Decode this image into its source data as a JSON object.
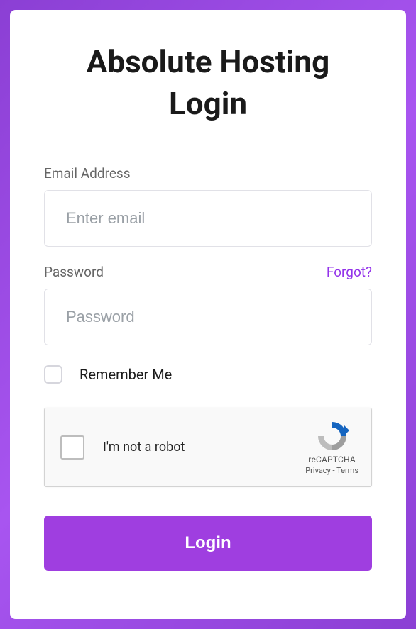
{
  "title": "Absolute Hosting Login",
  "email": {
    "label": "Email Address",
    "placeholder": "Enter email",
    "value": ""
  },
  "password": {
    "label": "Password",
    "placeholder": "Password",
    "value": "",
    "forgot_label": "Forgot?"
  },
  "remember": {
    "label": "Remember Me",
    "checked": false
  },
  "recaptcha": {
    "text": "I'm not a robot",
    "brand": "reCAPTCHA",
    "privacy": "Privacy",
    "terms": "Terms",
    "separator": " - "
  },
  "login_button": "Login"
}
